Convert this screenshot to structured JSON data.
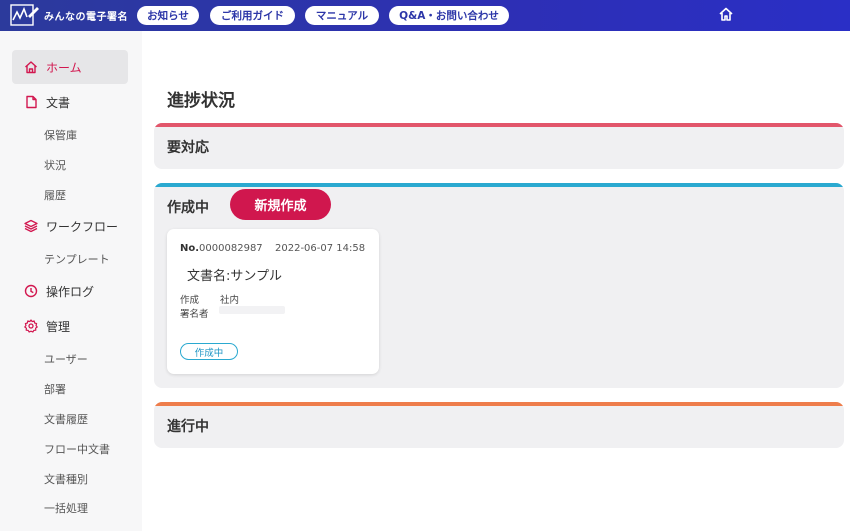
{
  "header": {
    "logo_text": "みんなの電子署名",
    "nav": [
      {
        "label": "お知らせ"
      },
      {
        "label": "ご利用ガイド"
      },
      {
        "label": "マニュアル"
      },
      {
        "label": "Q&A・お問い合わせ"
      }
    ],
    "home_icon": "home-icon"
  },
  "sidebar": {
    "home": {
      "label": "ホーム",
      "icon": "home-icon"
    },
    "documents": {
      "label": "文書",
      "icon": "document-icon"
    },
    "documents_sub": [
      "保管庫",
      "状況",
      "履歴"
    ],
    "workflow": {
      "label": "ワークフロー",
      "icon": "layers-icon"
    },
    "workflow_sub": [
      "テンプレート"
    ],
    "oplog": {
      "label": "操作ログ",
      "icon": "clock-icon"
    },
    "admin": {
      "label": "管理",
      "icon": "gear-icon"
    },
    "admin_sub": [
      "ユーザー",
      "部署",
      "文書履歴",
      "フロー中文書",
      "文書種別",
      "一括処理"
    ],
    "active_color": "#d2174f"
  },
  "main": {
    "title": "進捗状況",
    "sections": {
      "action_required": {
        "title": "要対応",
        "color": "#e2566b"
      },
      "drafting": {
        "title": "作成中",
        "color": "#2aa9d0",
        "new_button": "新規作成",
        "card": {
          "no_label": "No.",
          "no_value": "0000082987",
          "date": "2022-06-07 14:58",
          "doc_name": "文書名:サンプル",
          "creator_label": "作成",
          "creator_value": "社内",
          "signer_label": "署名者",
          "status": "作成中"
        }
      },
      "in_progress": {
        "title": "進行中",
        "color": "#ee7d4b"
      }
    }
  }
}
